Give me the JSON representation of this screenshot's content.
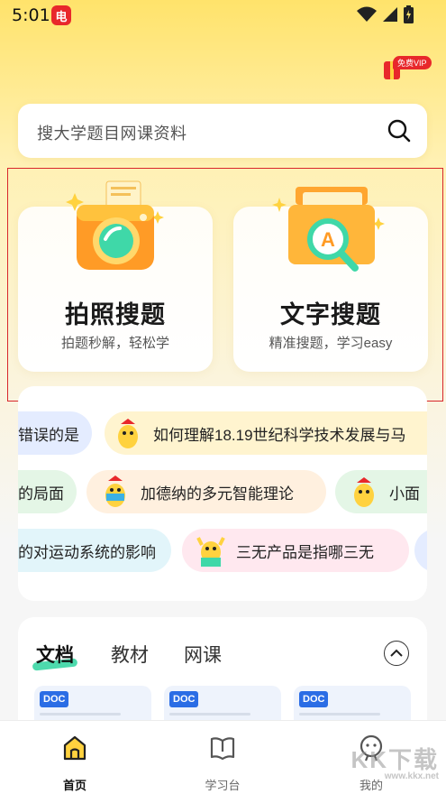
{
  "status_bar": {
    "time": "5:01",
    "app_icon_glyph": "电"
  },
  "vip_badge": {
    "label": "免费VIP"
  },
  "search": {
    "placeholder": "搜大学题目网课资料"
  },
  "features": [
    {
      "title": "拍照搜题",
      "subtitle": "拍题秒解，轻松学",
      "icon": "camera-icon"
    },
    {
      "title": "文字搜题",
      "subtitle": "精准搜题，学习easy",
      "icon": "folder-a-icon"
    }
  ],
  "topics": {
    "row1": [
      "错误的是",
      "如何理解18.19世纪科学技术发展与马"
    ],
    "row2": [
      "的局面",
      "加德纳的多元智能理论",
      "小面"
    ],
    "row3": [
      "的对运动系统的影响",
      "三无产品是指哪三无"
    ]
  },
  "resources": {
    "tabs": [
      "文档",
      "教材",
      "网课"
    ],
    "doc_badge": "DOC"
  },
  "bottom_nav": {
    "items": [
      {
        "label": "首页",
        "icon": "home-icon"
      },
      {
        "label": "学习台",
        "icon": "book-icon"
      },
      {
        "label": "我的",
        "icon": "profile-icon"
      }
    ]
  },
  "watermark": {
    "text": "KK下载",
    "url": "www.kkx.net"
  },
  "colors": {
    "accent": "#ffd23f",
    "highlight_frame": "#d8262b",
    "tab_underline": "#3ad6a4"
  }
}
